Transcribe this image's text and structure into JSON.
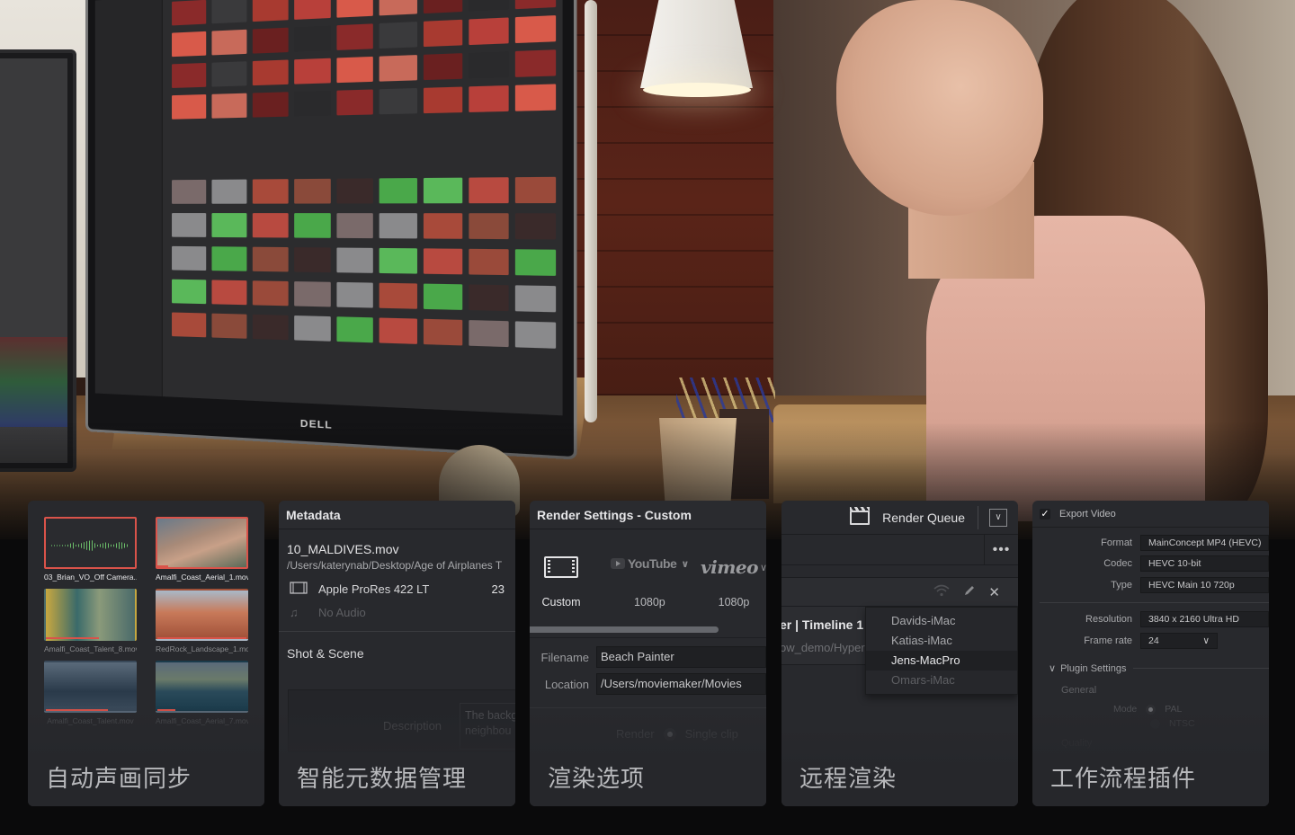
{
  "hero": {
    "monitor_brand": "DELL",
    "description": "Woman at desk viewing DaVinci Resolve media page on monitor"
  },
  "panels": {
    "sync": {
      "caption": "自动声画同步",
      "clips": [
        {
          "name": "03_Brian_VO_Off Camera....",
          "type": "audio",
          "selected": true,
          "state": "normal"
        },
        {
          "name": "Amalfi_Coast_Aerial_1.mov",
          "type": "video",
          "selected": true,
          "state": "normal"
        },
        {
          "name": "Amalfi_Coast_Talent_8.mov",
          "type": "video",
          "selected": false,
          "state": "dim"
        },
        {
          "name": "RedRock_Landscape_1.mov",
          "type": "video",
          "selected": false,
          "state": "dim"
        },
        {
          "name": "Amalfi_Coast_Talent.mov",
          "type": "video",
          "selected": false,
          "state": "faint"
        },
        {
          "name": "Amalfi_Coast_Aerial_7.mov",
          "type": "video",
          "selected": false,
          "state": "faint"
        }
      ]
    },
    "metadata": {
      "header": "Metadata",
      "file_name": "10_MALDIVES.mov",
      "file_path": "/Users/katerynab/Desktop/Age of Airplanes T",
      "codec": "Apple ProRes 422 LT",
      "codec_value": "23",
      "audio": "No Audio",
      "section": "Shot & Scene",
      "description_label": "Description",
      "description_text_line1": "The backg",
      "description_text_line2": "neighbou",
      "caption": "智能元数据管理"
    },
    "render": {
      "header": "Render Settings - Custom",
      "presets": [
        {
          "brand": "custom",
          "label": "Custom",
          "active": true
        },
        {
          "brand": "YouTube",
          "label": "1080p",
          "active": false
        },
        {
          "brand": "vimeo",
          "label": "1080p",
          "active": false
        }
      ],
      "filename_label": "Filename",
      "filename_value": "Beach Painter",
      "location_label": "Location",
      "location_value": "/Users/moviemaker/Movies",
      "render_label": "Render",
      "render_option": "Single clip",
      "caption": "渲染选项"
    },
    "queue": {
      "header": "Render Queue",
      "more": "•••",
      "job_name": "er | Timeline 1",
      "job_path": "ow_demo/Hyper",
      "machines": [
        {
          "name": "Davids-iMac",
          "state": "normal"
        },
        {
          "name": "Katias-iMac",
          "state": "normal"
        },
        {
          "name": "Jens-MacPro",
          "state": "highlighted"
        },
        {
          "name": "Omars-iMac",
          "state": "dim"
        }
      ],
      "caption": "远程渲染"
    },
    "export": {
      "export_video_label": "Export Video",
      "export_video_checked": true,
      "format_label": "Format",
      "format_value": "MainConcept MP4 (HEVC)",
      "codec_label": "Codec",
      "codec_value": "HEVC 10-bit",
      "type_label": "Type",
      "type_value": "HEVC Main 10 720p",
      "resolution_label": "Resolution",
      "resolution_value": "3840 x 2160 Ultra HD",
      "framerate_label": "Frame rate",
      "framerate_value": "24",
      "plugin_settings": "Plugin Settings",
      "general": "General",
      "mode_label": "Mode",
      "mode_options": [
        "PAL",
        "NTSC"
      ],
      "mode_selected": "PAL",
      "quality": "Quality",
      "caption": "工作流程插件"
    }
  },
  "colors": {
    "panel_bg": "#28292d",
    "page_bg": "#0a0a0b",
    "selection_red": "#d9534a",
    "waveform_green": "#6cbf6a"
  }
}
